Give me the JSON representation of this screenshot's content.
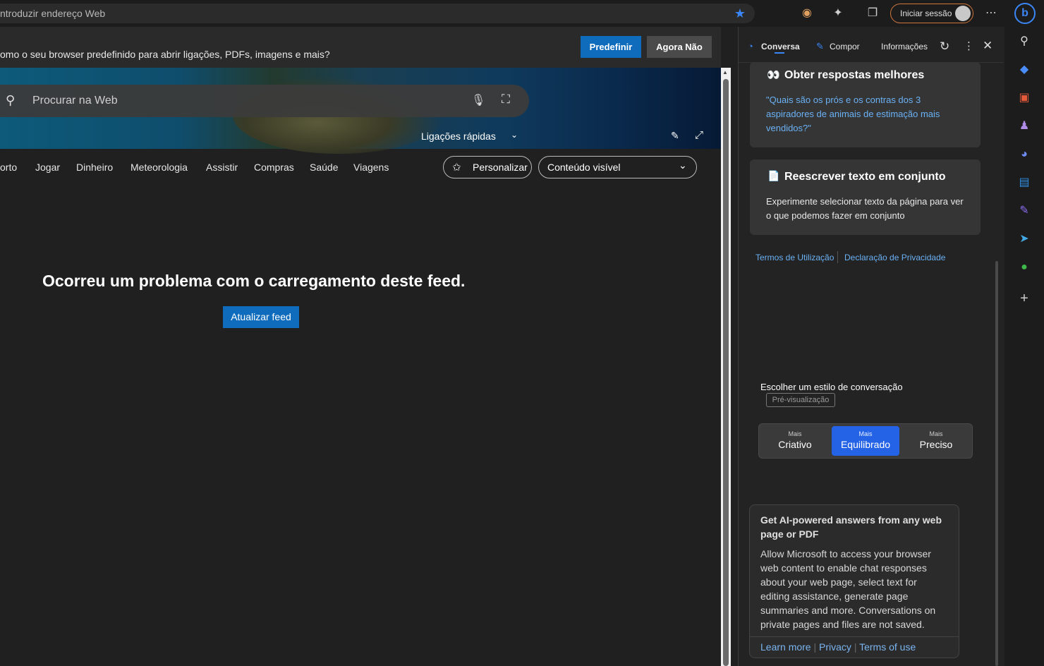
{
  "address_bar": {
    "placeholder": "ntroduzir endereço Web",
    "signin_label": "Iniciar sessão"
  },
  "banner": {
    "text": "omo o seu browser predefinido para abrir ligações, PDFs, imagens e mais?",
    "primary_label": "Predefinir",
    "secondary_label": "Agora Não"
  },
  "search": {
    "placeholder": "Procurar na Web",
    "quick_links_label": "Ligações rápidas"
  },
  "nav": {
    "items": [
      "orto",
      "Jogar",
      "Dinheiro",
      "Meteorologia",
      "Assistir",
      "Compras",
      "Saúde",
      "Viagens"
    ],
    "personalize_label": "Personalizar",
    "content_select_value": "Conteúdo visível"
  },
  "feed": {
    "error_message": "Ocorreu um problema com o carregamento deste feed.",
    "refresh_label": "Atualizar feed"
  },
  "panel": {
    "tabs": [
      "Conversa",
      "Compor",
      "Informações"
    ],
    "active_tab": "Conversa",
    "card1": {
      "title": "Obter respostas melhores",
      "body": "\"Quais são os prós e os contras dos 3 aspiradores de animais de estimação mais vendidos?\""
    },
    "card2": {
      "title": "Reescrever texto em conjunto",
      "body": "Experimente selecionar texto da página para ver o que podemos fazer em conjunto"
    },
    "terms_label": "Termos de Utilização",
    "privacy_label": "Declaração de Privacidade",
    "style_title": "Escolher um estilo de conversação",
    "preview_tag": "Pré-visualização",
    "styles": [
      {
        "small": "Mais",
        "main": "Criativo"
      },
      {
        "small": "Mais",
        "main": "Equilibrado"
      },
      {
        "small": "Mais",
        "main": "Preciso"
      }
    ],
    "selected_style": "Equilibrado",
    "ai_card": {
      "title": "Get AI-powered answers from any web page or PDF",
      "body": "Allow Microsoft to access your browser web content to enable chat responses about your web page, select text for editing assistance, generate page summaries and more. Conversations on private pages and files are not saved.",
      "links": [
        "Learn more",
        "Privacy",
        "Terms of use"
      ]
    }
  },
  "colors": {
    "accent": "#0f6cbd",
    "selected_style": "#2563e6",
    "link": "#6ab1f5"
  }
}
